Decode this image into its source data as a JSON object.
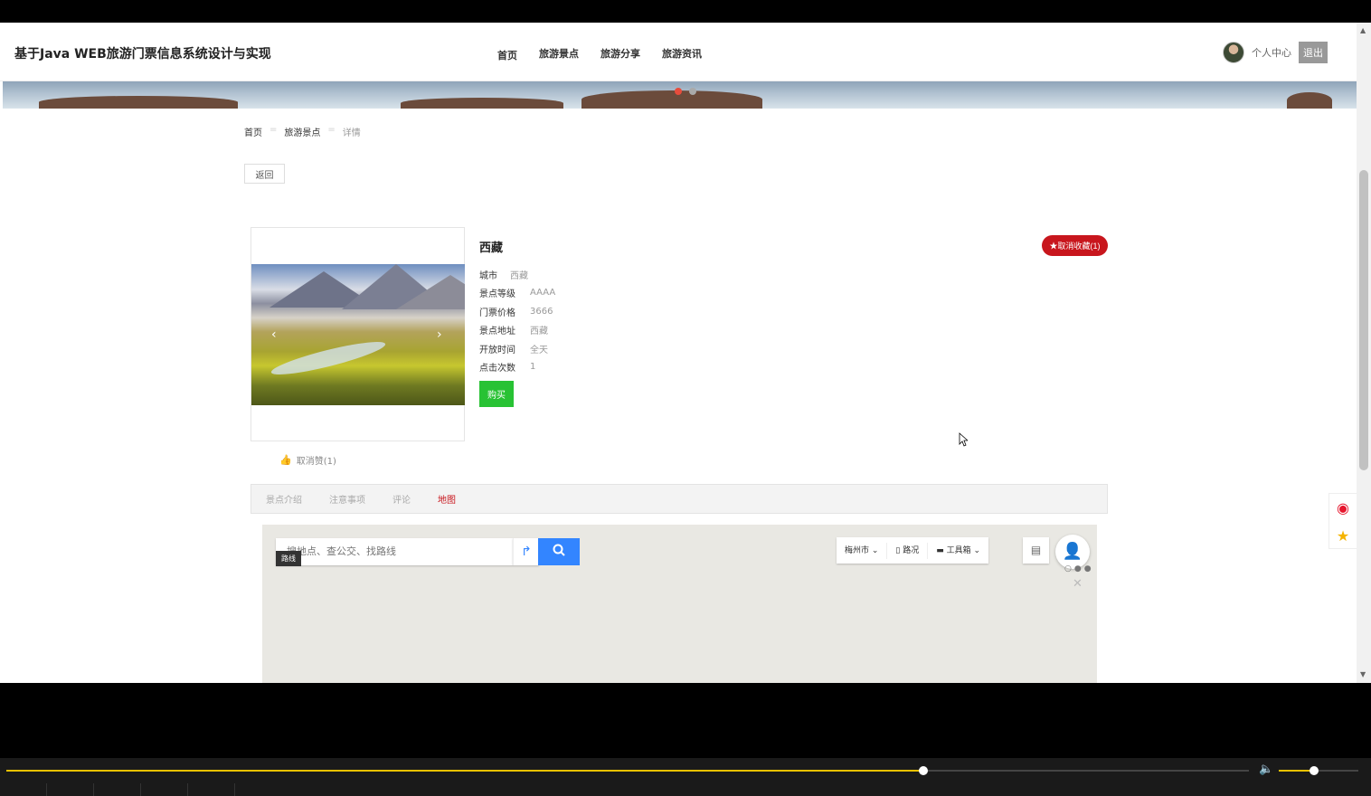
{
  "header": {
    "site_title": "基于Java WEB旅游门票信息系统设计与实现",
    "nav": [
      "首页",
      "旅游景点",
      "旅游分享",
      "旅游资讯"
    ],
    "user_center": "个人中心",
    "logout": "退出"
  },
  "breadcrumb": {
    "home": "首页",
    "section": "旅游景点",
    "current": "详情",
    "separator": "="
  },
  "back_label": "返回",
  "spot": {
    "name": "西藏",
    "favorite_label": "★取消收藏(1)",
    "info": [
      {
        "label": "城市",
        "value": "西藏"
      },
      {
        "label": "景点等级",
        "value": "AAAA"
      },
      {
        "label": "门票价格",
        "value": "3666"
      },
      {
        "label": "景点地址",
        "value": "西藏"
      },
      {
        "label": "开放时间",
        "value": "全天"
      },
      {
        "label": "点击次数",
        "value": "1"
      }
    ],
    "buy_label": "购买",
    "like_label": "取消赞(1)"
  },
  "tabs": {
    "items": [
      "景点介绍",
      "注意事项",
      "评论",
      "地图"
    ],
    "active_index": 3
  },
  "map": {
    "search_placeholder": "搜地点、查公交、找路线",
    "route_tip": "路线",
    "city": "梅州市",
    "traffic": "路况",
    "toolbox": "工具箱"
  },
  "player": {
    "progress_fraction": 0.738,
    "volume_fraction": 0.44
  },
  "colors": {
    "accent_red": "#c8161d",
    "buy_green": "#28c234",
    "map_blue": "#3385ff",
    "progress_yellow": "#e8c100"
  },
  "icons": {
    "like": "thumbs-up-icon",
    "weibo": "weibo-icon",
    "favorite": "star-icon",
    "search": "search-icon",
    "route": "route-icon",
    "user": "user-icon"
  }
}
